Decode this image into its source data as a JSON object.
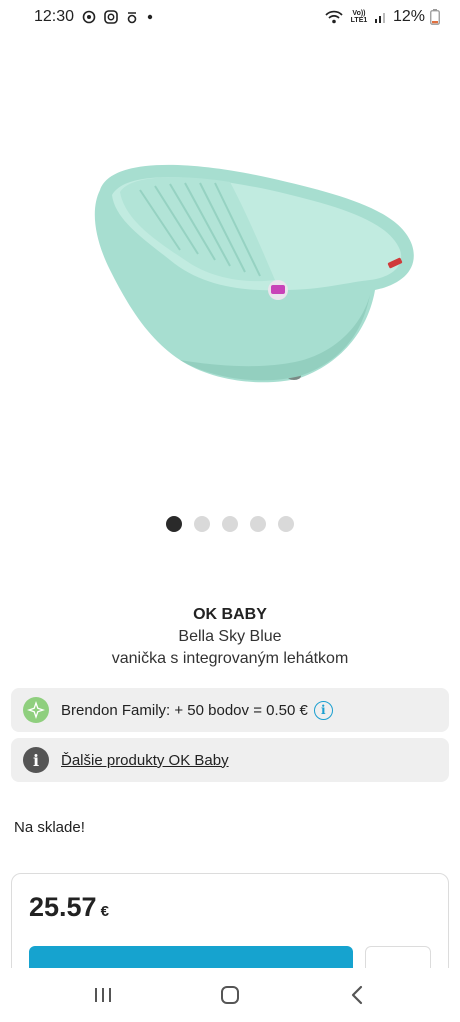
{
  "status_bar": {
    "time": "12:30",
    "volte_label": "Vo)) LTE1",
    "battery_percent": "12%",
    "battery_level": 0.12
  },
  "product": {
    "image_icon": "baby-bathtub-image",
    "brand": "OK BABY",
    "name": "Bella Sky Blue",
    "description": "vanička s integrovaným lehátkom",
    "tub_color": "#a7ded0"
  },
  "carousel": {
    "total": 5,
    "active_index": 0
  },
  "loyalty": {
    "text": "Brendon Family: + 50 bodov = 0.50 €"
  },
  "more_products": {
    "link_text": "Ďalšie produkty OK Baby"
  },
  "stock": {
    "status": "Na sklade!"
  },
  "price": {
    "value": "25.57",
    "currency": "€"
  },
  "colors": {
    "accent": "#16a3cf",
    "info_bg": "#efefef"
  }
}
